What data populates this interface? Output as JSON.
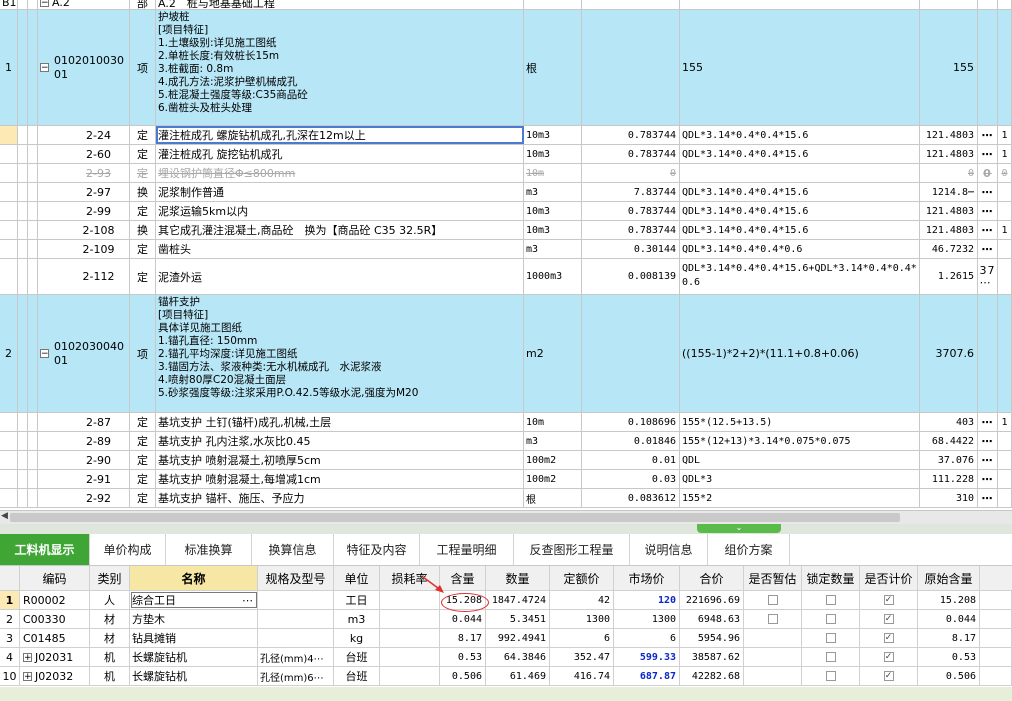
{
  "top_partial_row": {
    "no": "B1",
    "code": "A.2",
    "type": "部",
    "name": "A.2　桩与地基基础工程"
  },
  "upper_rows": [
    {
      "kind": "item",
      "no": "1",
      "code1": "0102010030",
      "code2": "01",
      "type": "项",
      "features": "护坡桩\n[项目特征]\n1.土壤级别:详见施工图纸\n2.单桩长度:有效桩长15m\n3.桩截面: 0.8m\n4.成孔方法:泥浆护壁机械成孔\n5.桩混凝土强度等级:C35商品砼\n6.凿桩头及桩头处理",
      "unit": "根",
      "expr": "155",
      "amount": "155"
    },
    {
      "kind": "quota",
      "code": "2-24",
      "type": "定",
      "name": "灌注桩成孔 螺旋钻机成孔,孔深在12m以上",
      "unit": "10m3",
      "content": "0.783744",
      "expr": "QDL*3.14*0.4*0.4*15.6",
      "amount": "121.4803",
      "extra": "⋯",
      "last": "1"
    },
    {
      "kind": "quota",
      "code": "2-60",
      "type": "定",
      "name": "灌注桩成孔 旋挖钻机成孔",
      "unit": "10m3",
      "content": "0.783744",
      "expr": "QDL*3.14*0.4*0.4*15.6",
      "amount": "121.4803",
      "extra": "⋯",
      "last": "1"
    },
    {
      "kind": "struck",
      "code": "2-93",
      "type": "定",
      "name": "埋设钢护筒直径Φ≤800mm",
      "unit": "10m",
      "content": "0",
      "expr": "",
      "amount": "0",
      "extra": "0",
      "last": "0"
    },
    {
      "kind": "quota",
      "code": "2-97",
      "type": "换",
      "name": "泥浆制作普通",
      "unit": "m3",
      "content": "7.83744",
      "expr": "QDL*3.14*0.4*0.4*15.6",
      "amount": "1214.8⋯",
      "extra": "⋯",
      "last": ""
    },
    {
      "kind": "quota",
      "code": "2-99",
      "type": "定",
      "name": "泥浆运输5km以内",
      "unit": "10m3",
      "content": "0.783744",
      "expr": "QDL*3.14*0.4*0.4*15.6",
      "amount": "121.4803",
      "extra": "⋯",
      "last": ""
    },
    {
      "kind": "quota",
      "code": "2-108",
      "type": "换",
      "name": "其它成孔灌注混凝土,商品砼　换为【商品砼 C35 32.5R】",
      "unit": "10m3",
      "content": "0.783744",
      "expr": "QDL*3.14*0.4*0.4*15.6",
      "amount": "121.4803",
      "extra": "⋯",
      "last": "1"
    },
    {
      "kind": "quota",
      "code": "2-109",
      "type": "定",
      "name": "凿桩头",
      "unit": "m3",
      "content": "0.30144",
      "expr": "QDL*3.14*0.4*0.4*0.6",
      "amount": "46.7232",
      "extra": "⋯",
      "last": ""
    },
    {
      "kind": "tall",
      "code": "2-112",
      "type": "定",
      "name": "泥渣外运",
      "unit": "1000m3",
      "content": "0.008139",
      "expr": "QDL*3.14*0.4*0.4*15.6+QDL*3.14*0.4*0.4*\n0.6",
      "amount": "1.2615",
      "extra": "37\n⋯",
      "last": ""
    },
    {
      "kind": "item",
      "no": "2",
      "code1": "0102030040",
      "code2": "01",
      "type": "项",
      "features": "锚杆支护\n[项目特征]\n具体详见施工图纸\n1.锚孔直径: 150mm\n2.锚孔平均深度:详见施工图纸\n3.锚固方法、浆液种类:无水机械成孔　水泥浆液\n4.喷射80厚C20混凝土面层\n5.砂浆强度等级:注浆采用P.O.42.5等级水泥,强度为M20",
      "unit": "m2",
      "expr": "((155-1)*2+2)*(11.1+0.8+0.06)",
      "amount": "3707.6"
    },
    {
      "kind": "quota",
      "code": "2-87",
      "type": "定",
      "name": "基坑支护 土钉(锚杆)成孔,机械,土层",
      "unit": "10m",
      "content": "0.108696",
      "expr": "155*(12.5+13.5)",
      "amount": "403",
      "extra": "⋯",
      "last": "1"
    },
    {
      "kind": "quota",
      "code": "2-89",
      "type": "定",
      "name": "基坑支护 孔内注浆,水灰比0.45",
      "unit": "m3",
      "content": "0.01846",
      "expr": "155*(12+13)*3.14*0.075*0.075",
      "amount": "68.4422",
      "extra": "⋯",
      "last": ""
    },
    {
      "kind": "quota",
      "code": "2-90",
      "type": "定",
      "name": "基坑支护 喷射混凝土,初喷厚5cm",
      "unit": "100m2",
      "content": "0.01",
      "expr": "QDL",
      "amount": "37.076",
      "extra": "⋯",
      "last": ""
    },
    {
      "kind": "quota",
      "code": "2-91",
      "type": "定",
      "name": "基坑支护 喷射混凝土,每增减1cm",
      "unit": "100m2",
      "content": "0.03",
      "expr": "QDL*3",
      "amount": "111.228",
      "extra": "⋯",
      "last": ""
    },
    {
      "kind": "quota",
      "code": "2-92",
      "type": "定",
      "name": "基坑支护 锚杆、施压、予应力",
      "unit": "根",
      "content": "0.083612",
      "expr": "155*2",
      "amount": "310",
      "extra": "⋯",
      "last": ""
    }
  ],
  "tabs": [
    "工料机显示",
    "单价构成",
    "标准换算",
    "换算信息",
    "特征及内容",
    "工程量明细",
    "反查图形工程量",
    "说明信息",
    "组价方案"
  ],
  "lower_headers": [
    "编码",
    "类别",
    "名称",
    "规格及型号",
    "单位",
    "损耗率",
    "含量",
    "数量",
    "定额价",
    "市场价",
    "合价",
    "是否暂估",
    "锁定数量",
    "是否计价",
    "原始含量"
  ],
  "lower_rows": [
    {
      "no": "1",
      "expand": false,
      "code": "R00002",
      "cat": "人",
      "name": "综合工日",
      "spec": "",
      "unit": "工日",
      "loss": "",
      "content": "15.208",
      "qty": "1847.4724",
      "quota": "42",
      "market": "120",
      "total": "221696.69",
      "est": false,
      "lock": false,
      "price": true,
      "orig": "15.208"
    },
    {
      "no": "2",
      "expand": false,
      "code": "C00330",
      "cat": "材",
      "name": "方垫木",
      "spec": "",
      "unit": "m3",
      "loss": "",
      "content": "0.044",
      "qty": "5.3451",
      "quota": "1300",
      "market": "1300",
      "total": "6948.63",
      "est": false,
      "lock": false,
      "price": true,
      "orig": "0.044"
    },
    {
      "no": "3",
      "expand": false,
      "code": "C01485",
      "cat": "材",
      "name": "钻具摊销",
      "spec": "",
      "unit": "kg",
      "loss": "",
      "content": "8.17",
      "qty": "992.4941",
      "quota": "6",
      "market": "6",
      "total": "5954.96",
      "est": null,
      "lock": false,
      "price": true,
      "orig": "8.17"
    },
    {
      "no": "4",
      "expand": true,
      "code": "J02031",
      "cat": "机",
      "name": "长螺旋钻机",
      "spec": "孔径(mm)4⋯",
      "unit": "台班",
      "loss": "",
      "content": "0.53",
      "qty": "64.3846",
      "quota": "352.47",
      "market": "599.33",
      "total": "38587.62",
      "est": null,
      "lock": false,
      "price": true,
      "orig": "0.53"
    },
    {
      "no": "10",
      "expand": true,
      "code": "J02032",
      "cat": "机",
      "name": "长螺旋钻机",
      "spec": "孔径(mm)6⋯",
      "unit": "台班",
      "loss": "",
      "content": "0.506",
      "qty": "61.469",
      "quota": "416.74",
      "market": "687.87",
      "total": "42282.68",
      "est": null,
      "lock": false,
      "price": true,
      "orig": "0.506"
    }
  ],
  "colors": {
    "highlight": "#b7e6f6",
    "tab_active": "#3fa535",
    "market_blue": "#0b26c9",
    "annotation_red": "#e03030"
  }
}
